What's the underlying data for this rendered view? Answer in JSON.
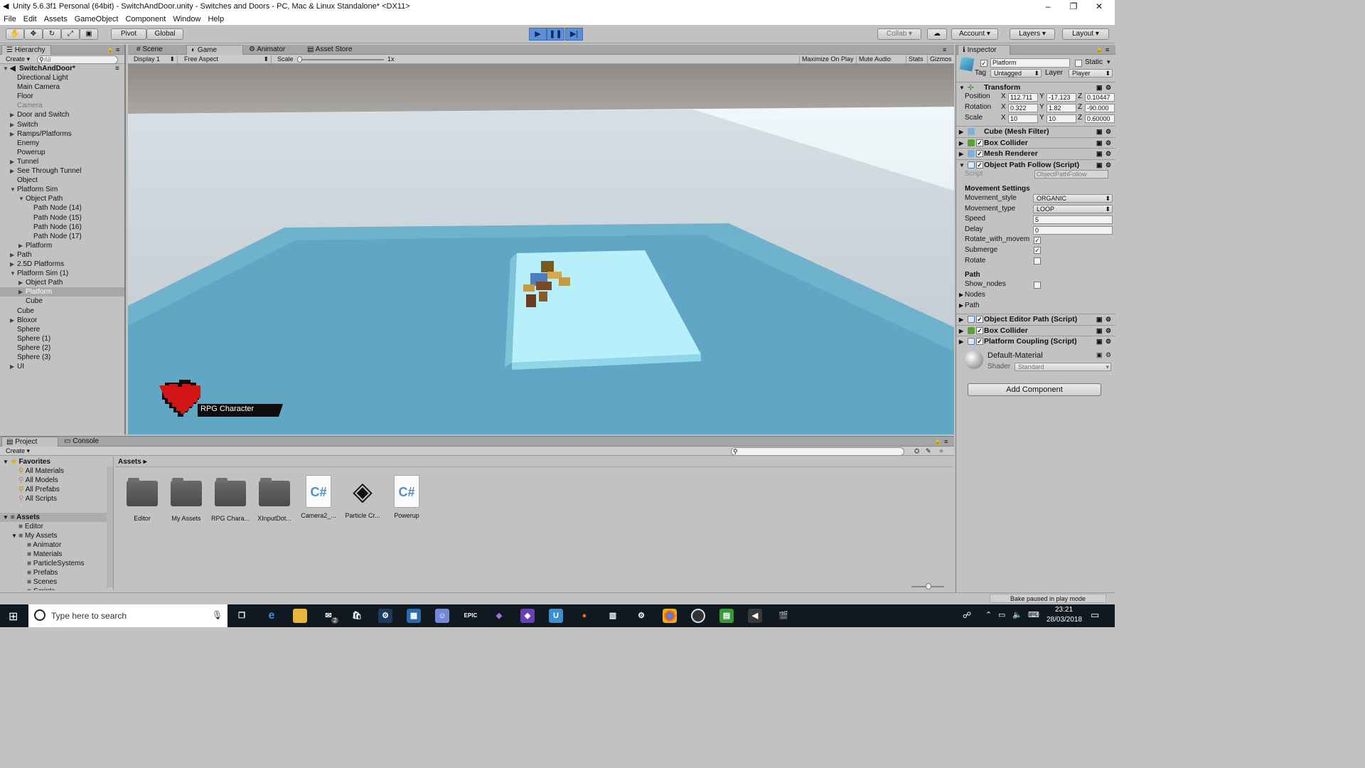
{
  "window": {
    "title": "Unity 5.6.3f1 Personal (64bit) - SwitchAndDoor.unity - Switches and Doors - PC, Mac & Linux Standalone* <DX11>",
    "minimize": "–",
    "maximize": "❐",
    "close": "✕"
  },
  "menu": [
    "File",
    "Edit",
    "Assets",
    "GameObject",
    "Component",
    "Window",
    "Help"
  ],
  "toolbar": {
    "pivot": "Pivot",
    "global": "Global",
    "collab": "Collab",
    "account": "Account",
    "layers": "Layers",
    "layout": "Layout"
  },
  "hierarchy": {
    "tab": "Hierarchy",
    "create": "Create",
    "search_placeholder": "All",
    "scene": "SwitchAndDoor*",
    "items": [
      {
        "label": "Directional Light",
        "depth": 1,
        "arrow": ""
      },
      {
        "label": "Main Camera",
        "depth": 1,
        "arrow": ""
      },
      {
        "label": "Floor",
        "depth": 1,
        "arrow": ""
      },
      {
        "label": "Camera",
        "depth": 1,
        "arrow": "",
        "dim": true
      },
      {
        "label": "Door and Switch",
        "depth": 1,
        "arrow": "▶"
      },
      {
        "label": "Switch",
        "depth": 1,
        "arrow": "▶"
      },
      {
        "label": "Ramps/Platforms",
        "depth": 1,
        "arrow": "▶"
      },
      {
        "label": "Enemy",
        "depth": 1,
        "arrow": ""
      },
      {
        "label": "Powerup",
        "depth": 1,
        "arrow": ""
      },
      {
        "label": "Tunnel",
        "depth": 1,
        "arrow": "▶"
      },
      {
        "label": "See Through Tunnel",
        "depth": 1,
        "arrow": "▶"
      },
      {
        "label": "Object",
        "depth": 1,
        "arrow": ""
      },
      {
        "label": "Platform Sim",
        "depth": 1,
        "arrow": "▼"
      },
      {
        "label": "Object Path",
        "depth": 2,
        "arrow": "▼"
      },
      {
        "label": "Path Node (14)",
        "depth": 3,
        "arrow": ""
      },
      {
        "label": "Path Node (15)",
        "depth": 3,
        "arrow": ""
      },
      {
        "label": "Path Node (16)",
        "depth": 3,
        "arrow": ""
      },
      {
        "label": "Path Node (17)",
        "depth": 3,
        "arrow": ""
      },
      {
        "label": "Platform",
        "depth": 2,
        "arrow": "▶"
      },
      {
        "label": "Path",
        "depth": 1,
        "arrow": "▶"
      },
      {
        "label": "2.5D Platforms",
        "depth": 1,
        "arrow": "▶"
      },
      {
        "label": "Platform Sim (1)",
        "depth": 1,
        "arrow": "▼"
      },
      {
        "label": "Object Path",
        "depth": 2,
        "arrow": "▶"
      },
      {
        "label": "Platform",
        "depth": 2,
        "arrow": "▶",
        "selected": true
      },
      {
        "label": "Cube",
        "depth": 2,
        "arrow": ""
      },
      {
        "label": "Cube",
        "depth": 1,
        "arrow": ""
      },
      {
        "label": "Bloxor",
        "depth": 1,
        "arrow": "▶"
      },
      {
        "label": "Sphere",
        "depth": 1,
        "arrow": ""
      },
      {
        "label": "Sphere (1)",
        "depth": 1,
        "arrow": ""
      },
      {
        "label": "Sphere (2)",
        "depth": 1,
        "arrow": ""
      },
      {
        "label": "Sphere (3)",
        "depth": 1,
        "arrow": ""
      },
      {
        "label": "UI",
        "depth": 1,
        "arrow": "▶"
      }
    ]
  },
  "game": {
    "tabs": [
      "Scene",
      "Game",
      "Animator",
      "Asset Store"
    ],
    "display": "Display 1",
    "aspect": "Free Aspect",
    "scale_label": "Scale",
    "scale_value": "1x",
    "toggles": [
      "Maximize On Play",
      "Mute Audio",
      "Stats",
      "Gizmos"
    ],
    "hud_label": "RPG Character"
  },
  "inspector": {
    "tab": "Inspector",
    "name": "Platform",
    "static": "Static",
    "tag_label": "Tag",
    "tag": "Untagged",
    "layer_label": "Layer",
    "layer": "Player",
    "transform": {
      "title": "Transform",
      "position": {
        "label": "Position",
        "x": "112.711",
        "y": "-17.123",
        "z": "0.10447"
      },
      "rotation": {
        "label": "Rotation",
        "x": "0.322",
        "y": "1.82",
        "z": "-90.000"
      },
      "scale": {
        "label": "Scale",
        "x": "10",
        "y": "10",
        "z": "0.60000"
      }
    },
    "components": [
      "Cube (Mesh Filter)",
      "Box Collider",
      "Mesh Renderer",
      "Object Path Follow (Script)"
    ],
    "script_label": "Script",
    "script_value": "ObjectPathFollow",
    "movement_header": "Movement Settings",
    "movement_style": {
      "label": "Movement_style",
      "value": "ORGANIC"
    },
    "movement_type": {
      "label": "Movement_type",
      "value": "LOOP"
    },
    "speed": {
      "label": "Speed",
      "value": "5"
    },
    "delay": {
      "label": "Delay",
      "value": "0"
    },
    "rotate_with_movement": {
      "label": "Rotate_with_movem",
      "checked": true
    },
    "submerge": {
      "label": "Submerge",
      "checked": true
    },
    "rotate": {
      "label": "Rotate",
      "checked": false
    },
    "path_header": "Path",
    "show_nodes": {
      "label": "Show_nodes",
      "checked": false
    },
    "nodes": "Nodes",
    "path": "Path",
    "components2": [
      "Object Editor Path (Script)",
      "Box Collider",
      "Platform Coupling (Script)"
    ],
    "material": "Default-Material",
    "shader_label": "Shader",
    "shader": "Standard",
    "add_component": "Add Component"
  },
  "project": {
    "tabs": [
      "Project",
      "Console"
    ],
    "create": "Create",
    "favorites": {
      "label": "Favorites",
      "items": [
        "All Materials",
        "All Models",
        "All Prefabs",
        "All Scripts"
      ]
    },
    "assets_root": "Assets",
    "tree": [
      {
        "label": "Editor",
        "depth": 1
      },
      {
        "label": "My Assets",
        "depth": 1
      },
      {
        "label": "Animator",
        "depth": 2
      },
      {
        "label": "Materials",
        "depth": 2
      },
      {
        "label": "ParticleSystems",
        "depth": 2
      },
      {
        "label": "Prefabs",
        "depth": 2
      },
      {
        "label": "Scenes",
        "depth": 2
      },
      {
        "label": "Scripts",
        "depth": 2
      }
    ],
    "breadcrumb": "Assets",
    "assets": [
      {
        "label": "Editor",
        "kind": "folder"
      },
      {
        "label": "My Assets",
        "kind": "folder"
      },
      {
        "label": "RPG Chara...",
        "kind": "folder"
      },
      {
        "label": "XInputDot...",
        "kind": "folder"
      },
      {
        "label": "Camera2_...",
        "kind": "cs"
      },
      {
        "label": "Particle Cr...",
        "kind": "unity"
      },
      {
        "label": "Powerup",
        "kind": "cs"
      }
    ]
  },
  "status": {
    "right": "Bake paused in play mode"
  },
  "taskbar": {
    "search_placeholder": "Type here to search",
    "time": "23:21",
    "date": "28/03/2018",
    "mail_badge": "2"
  }
}
